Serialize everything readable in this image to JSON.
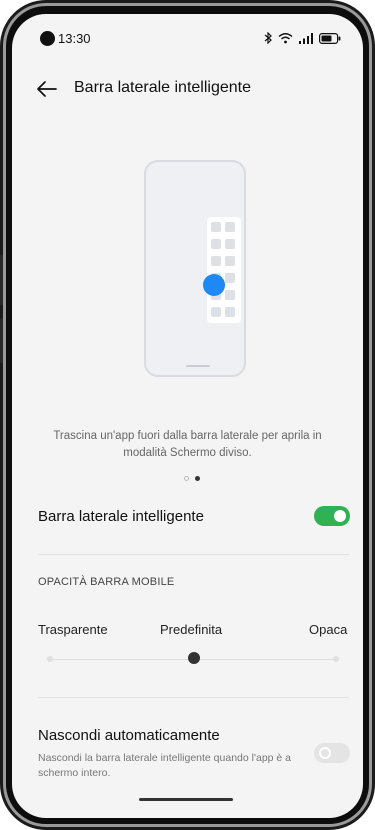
{
  "status_bar": {
    "time": "13:30",
    "icons": [
      "bluetooth-icon",
      "wifi-icon",
      "signal-icon",
      "battery-icon"
    ]
  },
  "header": {
    "back_icon": "arrow-left-icon",
    "title": "Barra laterale intelligente"
  },
  "illustration": {
    "caption": "Trascina un'app fuori dalla barra laterale per aprila in modalità Schermo diviso.",
    "accent_color": "#1e88f5",
    "pages_total": 2,
    "current_page": 2
  },
  "smart_sidebar": {
    "label": "Barra laterale intelligente",
    "enabled": true,
    "accent_color": "#2fb154"
  },
  "opacity": {
    "section_title": "OPACITÀ BARRA MOBILE",
    "options": [
      "Trasparente",
      "Predefinita",
      "Opaca"
    ],
    "selected": "Predefinita"
  },
  "auto_hide": {
    "label": "Nascondi automaticamente",
    "description": "Nascondi la barra laterale intelligente quando l'app è a schermo intero.",
    "enabled": false
  }
}
